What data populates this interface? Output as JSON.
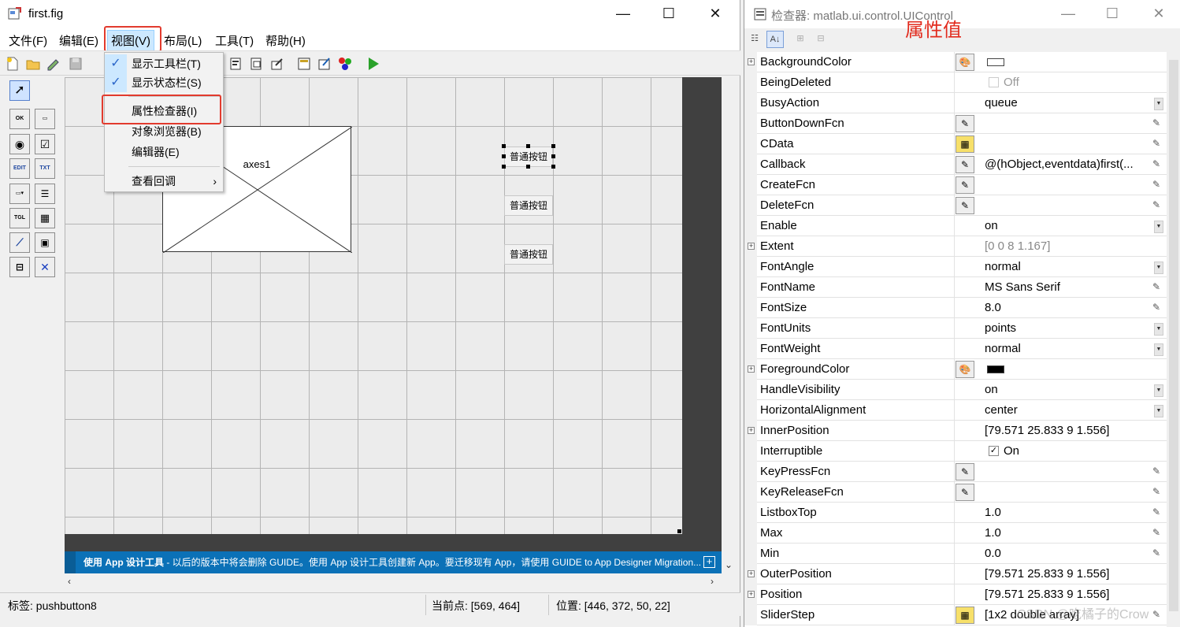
{
  "guide": {
    "title": "first.fig",
    "menu": [
      "文件(F)",
      "编辑(E)",
      "视图(V)",
      "布局(L)",
      "工具(T)",
      "帮助(H)"
    ],
    "dropdown": {
      "items": [
        "显示工具栏(T)",
        "显示状态栏(S)",
        "属性检查器(I)",
        "对象浏览器(B)",
        "编辑器(E)",
        "查看回调"
      ],
      "checked": [
        "显示工具栏(T)",
        "显示状态栏(S)"
      ]
    },
    "canvas": {
      "axes_label": "axes1",
      "buttons": [
        "普通按钮",
        "普通按钮",
        "普通按钮"
      ]
    },
    "banner": {
      "bold": "使用 App 设计工具",
      "text": " - 以后的版本中将会删除 GUIDE。使用 App 设计工具创建新 App。要迁移现有 App，请使用 GUIDE to App Designer Migration..."
    },
    "status": {
      "tag": "标签: pushbutton8",
      "current_point": "当前点:  [569, 464]",
      "position": "位置: [446, 372, 50, 22]"
    }
  },
  "inspector": {
    "title": "检查器:  matlab.ui.control.UIControl",
    "annotation": "属性值",
    "properties": [
      {
        "name": "BackgroundColor",
        "value": "",
        "expand": true,
        "edit": "palette",
        "kind": "swatch",
        "swatch": "#ffffff"
      },
      {
        "name": "BeingDeleted",
        "value": "Off",
        "kind": "checkbox",
        "checked": false
      },
      {
        "name": "BusyAction",
        "value": "queue",
        "kind": "dropdown"
      },
      {
        "name": "ButtonDownFcn",
        "value": "",
        "edit": "callback",
        "kind": "pencil"
      },
      {
        "name": "CData",
        "value": "",
        "edit": "grid",
        "kind": "pencil"
      },
      {
        "name": "Callback",
        "value": "@(hObject,eventdata)first(...",
        "edit": "callback",
        "kind": "pencil"
      },
      {
        "name": "CreateFcn",
        "value": "",
        "edit": "callback",
        "kind": "pencil"
      },
      {
        "name": "DeleteFcn",
        "value": "",
        "edit": "callback",
        "kind": "pencil"
      },
      {
        "name": "Enable",
        "value": "on",
        "kind": "dropdown"
      },
      {
        "name": "Extent",
        "value": "[0 0 8 1.167]",
        "expand": true,
        "kind": "gray"
      },
      {
        "name": "FontAngle",
        "value": "normal",
        "kind": "dropdown"
      },
      {
        "name": "FontName",
        "value": "MS Sans Serif",
        "kind": "pencil"
      },
      {
        "name": "FontSize",
        "value": "8.0",
        "kind": "pencil"
      },
      {
        "name": "FontUnits",
        "value": "points",
        "kind": "dropdown"
      },
      {
        "name": "FontWeight",
        "value": "normal",
        "kind": "dropdown"
      },
      {
        "name": "ForegroundColor",
        "value": "",
        "expand": true,
        "edit": "palette",
        "kind": "swatch",
        "swatch": "#000000"
      },
      {
        "name": "HandleVisibility",
        "value": "on",
        "kind": "dropdown"
      },
      {
        "name": "HorizontalAlignment",
        "value": "center",
        "kind": "dropdown"
      },
      {
        "name": "InnerPosition",
        "value": "[79.571 25.833 9 1.556]",
        "expand": true,
        "kind": "plain"
      },
      {
        "name": "Interruptible",
        "value": "On",
        "kind": "checkbox",
        "checked": true
      },
      {
        "name": "KeyPressFcn",
        "value": "",
        "edit": "callback",
        "kind": "pencil"
      },
      {
        "name": "KeyReleaseFcn",
        "value": "",
        "edit": "callback",
        "kind": "pencil"
      },
      {
        "name": "ListboxTop",
        "value": "1.0",
        "kind": "pencil"
      },
      {
        "name": "Max",
        "value": "1.0",
        "kind": "pencil"
      },
      {
        "name": "Min",
        "value": "0.0",
        "kind": "pencil"
      },
      {
        "name": "OuterPosition",
        "value": "[79.571 25.833 9 1.556]",
        "expand": true,
        "kind": "plain"
      },
      {
        "name": "Position",
        "value": "[79.571 25.833 9 1.556]",
        "expand": true,
        "kind": "plain"
      },
      {
        "name": "SliderStep",
        "value": "[1x2  double array]",
        "edit": "grid",
        "kind": "pencil"
      }
    ],
    "watermark": "CSDN @吃橘子的Crow"
  },
  "colors": {
    "highlight": "#e23b2e",
    "banner": "#0b71b7",
    "menu_active": "#cce8ff"
  }
}
